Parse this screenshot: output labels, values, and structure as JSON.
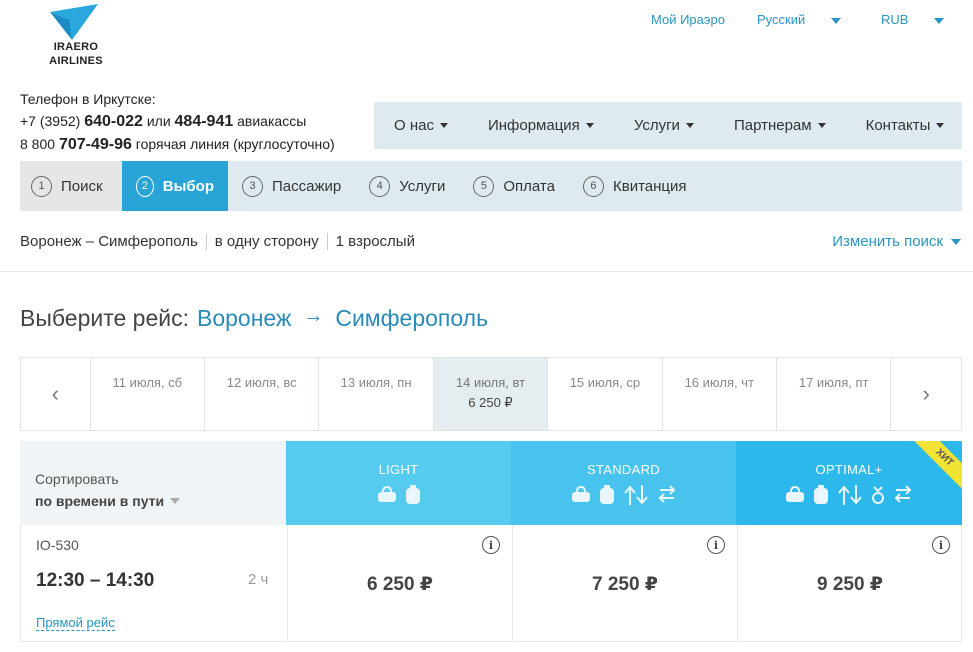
{
  "brand": {
    "line1": "IRAERO",
    "line2": "AIRLINES"
  },
  "toplinks": {
    "account": "Мой Ираэро",
    "language": "Русский",
    "currency": "RUB"
  },
  "contacts": {
    "label": "Телефон в Иркутске:",
    "phone1_prefix": "+7 (3952)",
    "phone1_num": "640-022",
    "or": "или",
    "phone2_num": "484-941",
    "phone2_suffix": "авиакассы",
    "hotline_prefix": "8 800",
    "hotline_num": "707-49-96",
    "hotline_suffix": "горячая линия (круглосуточно)"
  },
  "mainnav": [
    "О нас",
    "Информация",
    "Услуги",
    "Партнерам",
    "Контакты"
  ],
  "steps": [
    {
      "num": "1",
      "label": "Поиск"
    },
    {
      "num": "2",
      "label": "Выбор"
    },
    {
      "num": "3",
      "label": "Пассажир"
    },
    {
      "num": "4",
      "label": "Услуги"
    },
    {
      "num": "5",
      "label": "Оплата"
    },
    {
      "num": "6",
      "label": "Квитанция"
    }
  ],
  "summary": {
    "route": "Воронеж – Симферополь",
    "trip": "в одну сторону",
    "pax": "1 взрослый",
    "change": "Изменить поиск"
  },
  "heading": {
    "prefix": "Выберите рейс:",
    "from": "Воронеж",
    "arrow": "→",
    "to": "Симферополь"
  },
  "dates": [
    {
      "label": "11 июля, сб",
      "price": ""
    },
    {
      "label": "12 июля, вс",
      "price": ""
    },
    {
      "label": "13 июля, пн",
      "price": ""
    },
    {
      "label": "14 июля, вт",
      "price": "6 250 ₽"
    },
    {
      "label": "15 июля, ср",
      "price": ""
    },
    {
      "label": "16 июля, чт",
      "price": ""
    },
    {
      "label": "17 июля, пт",
      "price": ""
    }
  ],
  "sort": {
    "label": "Сортировать",
    "value": "по времени в пути"
  },
  "fares": {
    "light": "LIGHT",
    "standard": "STANDARD",
    "optimal": "OPTIMAL+",
    "badge": "ХИТ"
  },
  "flight": {
    "code": "IO-530",
    "time": "12:30 – 14:30",
    "duration": "2 ч",
    "direct": "Прямой рейс",
    "price_light": "6 250 ₽",
    "price_standard": "7 250 ₽",
    "price_optimal": "9 250 ₽"
  },
  "colors": {
    "accent": "#29a4d6",
    "light": "#55cbf0",
    "standard": "#47c3ee",
    "optimal": "#2cb8ea",
    "badge": "#f2e233"
  }
}
